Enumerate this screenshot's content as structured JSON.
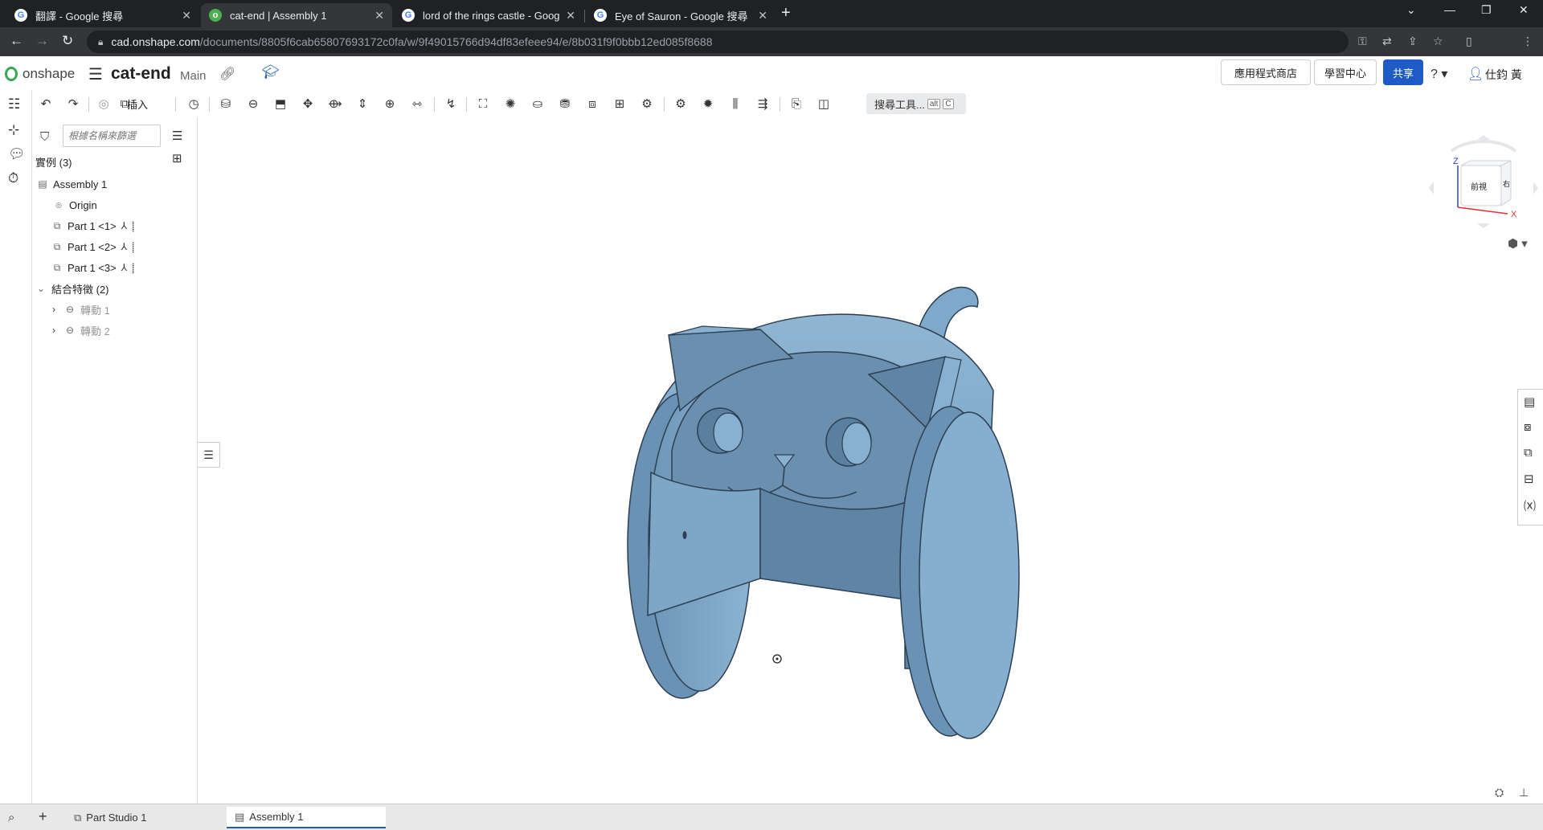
{
  "browser": {
    "tabs": [
      {
        "title": "翻譯 - Google 搜尋",
        "favicon": "google-icon"
      },
      {
        "title": "cat-end | Assembly 1",
        "favicon": "onshape-icon"
      },
      {
        "title": "lord of the rings castle - Google",
        "favicon": "google-icon"
      },
      {
        "title": "Eye of Sauron - Google 搜尋",
        "favicon": "google-icon"
      }
    ],
    "url_domain": "cad.onshape.com",
    "url_path": "/documents/8805f6cab65807693172c0fa/w/9f49015766d94df83efeee94/e/8b031f9f0bbb12ed085f8688"
  },
  "header": {
    "logo": "onshape",
    "document_title": "cat-end",
    "workspace": "Main",
    "app_store": "應用程式商店",
    "learning_center": "學習中心",
    "share": "共享",
    "user_name": "仕鈞 黃"
  },
  "toolbar": {
    "insert_label": "插入",
    "search_tools": "搜尋工具...",
    "shortcut_alt": "alt",
    "shortcut_c": "C"
  },
  "panel": {
    "filter_placeholder": "根據名稱來篩選",
    "instances_header": "實例 (3)",
    "assembly": "Assembly 1",
    "origin": "Origin",
    "parts": [
      "Part 1 <1>",
      "Part 1 <2>",
      "Part 1 <3>"
    ],
    "mate_features_header": "結合特徵 (2)",
    "mates": [
      "轉動 1",
      "轉動 2"
    ]
  },
  "viewcube": {
    "axis_z": "Z",
    "axis_x": "X",
    "front": "前視",
    "right": "右"
  },
  "bottom_tabs": [
    {
      "label": "Part Studio 1",
      "active": false
    },
    {
      "label": "Assembly 1",
      "active": true
    }
  ],
  "colors": {
    "accent": "#1e5bc6",
    "part_light": "#88b0d0",
    "part_mid": "#6d95b7",
    "part_dark": "#5a7f9f"
  }
}
